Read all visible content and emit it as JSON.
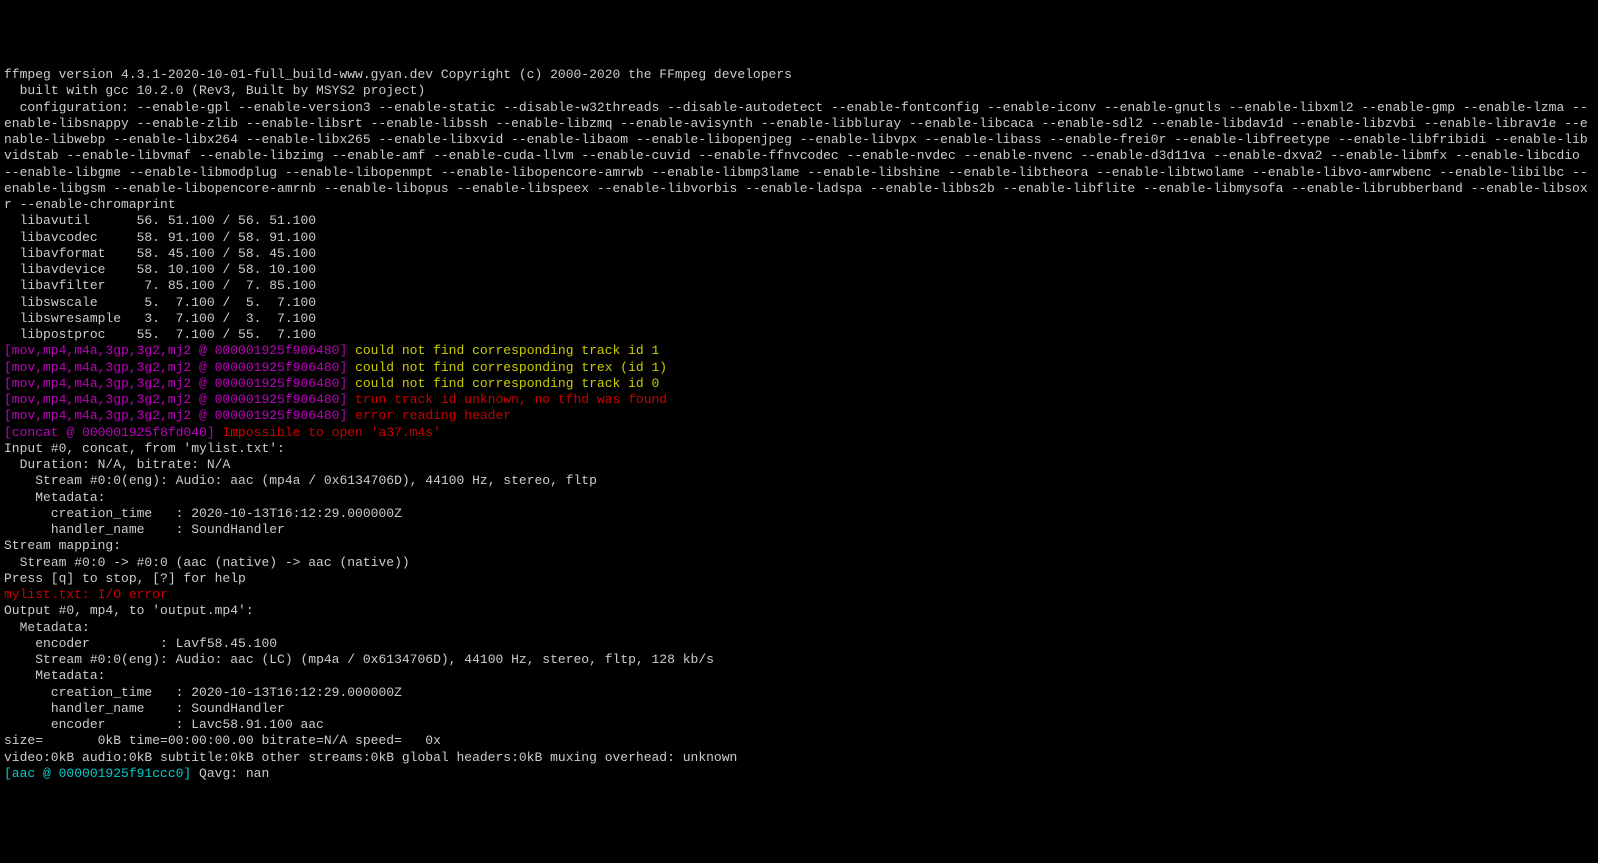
{
  "header": {
    "version_line": "ffmpeg version 4.3.1-2020-10-01-full_build-www.gyan.dev Copyright (c) 2000-2020 the FFmpeg developers",
    "built_line": "  built with gcc 10.2.0 (Rev3, Built by MSYS2 project)",
    "config_line": "  configuration: --enable-gpl --enable-version3 --enable-static --disable-w32threads --disable-autodetect --enable-fontconfig --enable-iconv --enable-gnutls --enable-libxml2 --enable-gmp --enable-lzma --enable-libsnappy --enable-zlib --enable-libsrt --enable-libssh --enable-libzmq --enable-avisynth --enable-libbluray --enable-libcaca --enable-sdl2 --enable-libdav1d --enable-libzvbi --enable-librav1e --enable-libwebp --enable-libx264 --enable-libx265 --enable-libxvid --enable-libaom --enable-libopenjpeg --enable-libvpx --enable-libass --enable-frei0r --enable-libfreetype --enable-libfribidi --enable-libvidstab --enable-libvmaf --enable-libzimg --enable-amf --enable-cuda-llvm --enable-cuvid --enable-ffnvcodec --enable-nvdec --enable-nvenc --enable-d3d11va --enable-dxva2 --enable-libmfx --enable-libcdio --enable-libgme --enable-libmodplug --enable-libopenmpt --enable-libopencore-amrwb --enable-libmp3lame --enable-libshine --enable-libtheora --enable-libtwolame --enable-libvo-amrwbenc --enable-libilbc --enable-libgsm --enable-libopencore-amrnb --enable-libopus --enable-libspeex --enable-libvorbis --enable-ladspa --enable-libbs2b --enable-libflite --enable-libmysofa --enable-librubberband --enable-libsoxr --enable-chromaprint"
  },
  "libs": [
    "  libavutil      56. 51.100 / 56. 51.100",
    "  libavcodec     58. 91.100 / 58. 91.100",
    "  libavformat    58. 45.100 / 58. 45.100",
    "  libavdevice    58. 10.100 / 58. 10.100",
    "  libavfilter     7. 85.100 /  7. 85.100",
    "  libswscale      5.  7.100 /  5.  7.100",
    "  libswresample   3.  7.100 /  3.  7.100",
    "  libpostproc    55.  7.100 / 55.  7.100"
  ],
  "mov_tag": "[mov,mp4,m4a,3gp,3g2,mj2 @ 000001925f906480] ",
  "mov_msgs_yellow": [
    "could not find corresponding track id 1",
    "could not find corresponding trex (id 1)",
    "could not find corresponding track id 0"
  ],
  "mov_msgs_red": [
    "trun track id unknown, no tfhd was found",
    "error reading header"
  ],
  "concat_tag": "[concat @ 000001925f8fd040] ",
  "concat_msg": "Impossible to open 'a37.m4s'",
  "input_block": [
    "Input #0, concat, from 'mylist.txt':",
    "  Duration: N/A, bitrate: N/A",
    "    Stream #0:0(eng): Audio: aac (mp4a / 0x6134706D), 44100 Hz, stereo, fltp",
    "    Metadata:",
    "      creation_time   : 2020-10-13T16:12:29.000000Z",
    "      handler_name    : SoundHandler",
    "Stream mapping:",
    "  Stream #0:0 -> #0:0 (aac (native) -> aac (native))",
    "Press [q] to stop, [?] for help"
  ],
  "io_error": "mylist.txt: I/O error",
  "output_block": [
    "Output #0, mp4, to 'output.mp4':",
    "  Metadata:",
    "    encoder         : Lavf58.45.100",
    "    Stream #0:0(eng): Audio: aac (LC) (mp4a / 0x6134706D), 44100 Hz, stereo, fltp, 128 kb/s",
    "    Metadata:",
    "      creation_time   : 2020-10-13T16:12:29.000000Z",
    "      handler_name    : SoundHandler",
    "      encoder         : Lavc58.91.100 aac",
    "size=       0kB time=00:00:00.00 bitrate=N/A speed=   0x",
    "video:0kB audio:0kB subtitle:0kB other streams:0kB global headers:0kB muxing overhead: unknown"
  ],
  "aac_tag": "[aac @ 000001925f91ccc0] ",
  "aac_msg": "Qavg: nan"
}
